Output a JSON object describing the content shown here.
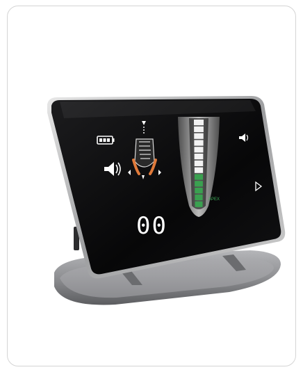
{
  "screen": {
    "apex_label": "APEX",
    "readout": "00",
    "icons": [
      "battery-icon",
      "speaker-icon",
      "tooth-file-icon",
      "volume-icon",
      "play-icon"
    ]
  },
  "colors": {
    "frame": "#c9c9c9",
    "screen": "#0b0b0c",
    "bar_white": "#f2f2f2",
    "bar_green": "#3aa150",
    "stand": "#8a8b8e"
  },
  "scale": {
    "total_segments": 13,
    "white_segments": 8,
    "green_segments": 5
  }
}
